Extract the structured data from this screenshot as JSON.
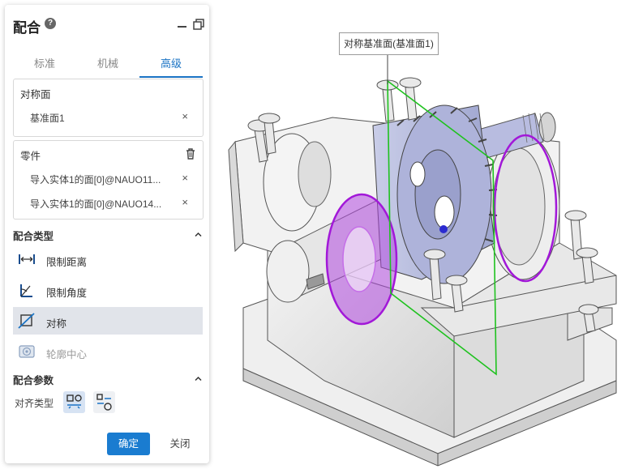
{
  "panel": {
    "title": "配合",
    "help_glyph": "?",
    "tabs": [
      "标准",
      "机械",
      "高级"
    ],
    "active_tab": "高级",
    "symmetry_plane": {
      "label": "对称面",
      "items": [
        "基准面1"
      ],
      "marker_color": "#22c322"
    },
    "parts": {
      "label": "零件",
      "items": [
        "导入实体1的面[0]@NAUO11...",
        "导入实体1的面[0]@NAUO14..."
      ],
      "marker_color": "#c31fd6"
    },
    "remove_glyph": "×",
    "mate_types": {
      "label": "配合类型",
      "items": [
        "限制距离",
        "限制角度",
        "对称",
        "轮廓中心"
      ],
      "selected": "对称",
      "disabled": "轮廓中心"
    },
    "mate_params": {
      "label": "配合参数",
      "align_label": "对齐类型"
    },
    "ok_label": "确定",
    "close_label": "关闭"
  },
  "viewport": {
    "tooltip": "对称基准面(基准面1)"
  },
  "colors": {
    "accent": "#1a73c4",
    "button": "#1a7cd0",
    "selection_purple": "#a218d8",
    "plane_green": "#1fc21f"
  }
}
